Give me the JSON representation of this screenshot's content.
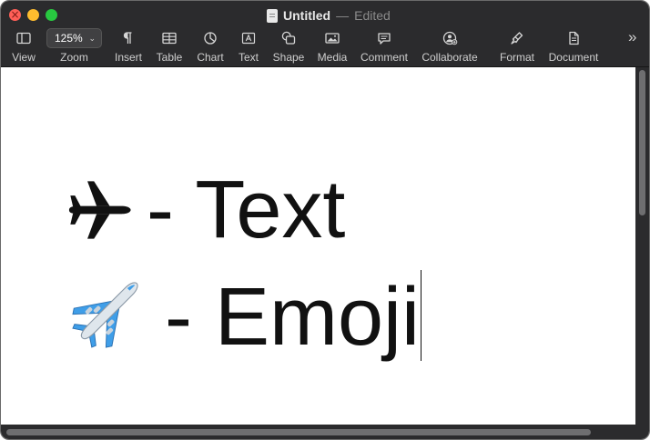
{
  "window": {
    "title": "Untitled",
    "separator": "—",
    "status": "Edited"
  },
  "toolbar": {
    "zoom_value": "125%",
    "items": [
      {
        "label": "View",
        "icon": "sidebar-icon"
      },
      {
        "label": "Zoom",
        "icon": "zoom-dropdown"
      },
      {
        "label": "Insert",
        "icon": "pilcrow-icon"
      },
      {
        "label": "Table",
        "icon": "table-icon"
      },
      {
        "label": "Chart",
        "icon": "pie-chart-icon"
      },
      {
        "label": "Text",
        "icon": "text-box-icon"
      },
      {
        "label": "Shape",
        "icon": "shape-icon"
      },
      {
        "label": "Media",
        "icon": "photo-icon"
      },
      {
        "label": "Comment",
        "icon": "speech-bubble-icon"
      },
      {
        "label": "Collaborate",
        "icon": "collaborate-icon"
      },
      {
        "label": "Format",
        "icon": "paintbrush-icon"
      },
      {
        "label": "Document",
        "icon": "document-icon"
      }
    ],
    "more_icon": "»"
  },
  "document": {
    "line1": {
      "symbol": "✈",
      "text": "- Text"
    },
    "line2": {
      "symbol": "✈️",
      "text": "- Emoji"
    }
  },
  "colors": {
    "toolbar_bg": "#2b2b2d",
    "close": "#ff5f57",
    "minimize": "#febc2e",
    "maximize": "#28c840",
    "emoji_plane_body": "#dfe6ec",
    "emoji_plane_wing": "#3f9ee8"
  }
}
